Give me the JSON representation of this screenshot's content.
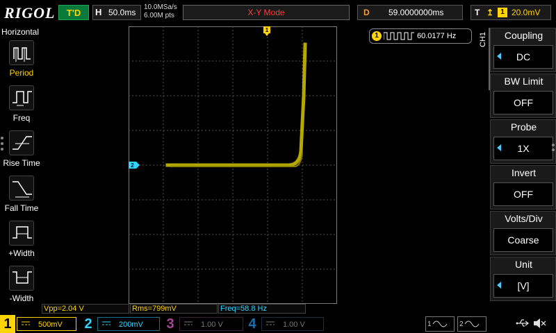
{
  "brand": "RIGOL",
  "header": {
    "run_state": "T'D",
    "horizontal_label": "H",
    "horizontal_scale": "50.0ms",
    "sample_rate": "10.0MSa/s",
    "memory_depth": "6.00M pts",
    "mode": "X-Y Mode",
    "delay_label": "D",
    "delay_value": "59.0000000ms",
    "trigger_label": "T",
    "trigger_channel": "1",
    "trigger_level": "20.0mV"
  },
  "left_menu": {
    "title": "Horizontal",
    "items": [
      {
        "label": "Period",
        "icon": "period-icon"
      },
      {
        "label": "Freq",
        "icon": "frequency-icon"
      },
      {
        "label": "Rise Time",
        "icon": "rise-time-icon"
      },
      {
        "label": "Fall Time",
        "icon": "fall-time-icon"
      },
      {
        "label": "+Width",
        "icon": "positive-width-icon"
      },
      {
        "label": "-Width",
        "icon": "negative-width-icon"
      }
    ]
  },
  "frequency_counter": {
    "channel": "1",
    "value": "60.0177 Hz"
  },
  "markers": {
    "ch1": "1",
    "ch2": "2"
  },
  "right_menu": {
    "tab": "CH1",
    "items": [
      {
        "title": "Coupling",
        "value": "DC",
        "arrow": true
      },
      {
        "title": "BW Limit",
        "value": "OFF",
        "arrow": false
      },
      {
        "title": "Probe",
        "value": "1X",
        "arrow": true
      },
      {
        "title": "Invert",
        "value": "OFF",
        "arrow": false
      },
      {
        "title": "Volts/Div",
        "value": "Coarse",
        "arrow": false
      },
      {
        "title": "Unit",
        "value": "[V]",
        "arrow": true
      }
    ]
  },
  "measurements": {
    "vpp": "Vpp=2.04 V",
    "rms": "Rms=799mV",
    "freq": "Freq=58.8 Hz"
  },
  "channels": [
    {
      "number": "1",
      "scale": "500mV",
      "color": "#ffd400",
      "active": true
    },
    {
      "number": "2",
      "scale": "200mV",
      "color": "#30d6ff",
      "active": true
    },
    {
      "number": "3",
      "scale": "1.00 V",
      "color": "#a8459a",
      "active": false
    },
    {
      "number": "4",
      "scale": "1.00 V",
      "color": "#1d6fa8",
      "active": false
    }
  ],
  "signal_sources": [
    "1",
    "2"
  ],
  "colors": {
    "trace": "#b5a800",
    "grid": "#7a7a7a",
    "ch1": "#ffd400",
    "ch2": "#30d6ff",
    "mode_text": "#ff3a3a"
  }
}
